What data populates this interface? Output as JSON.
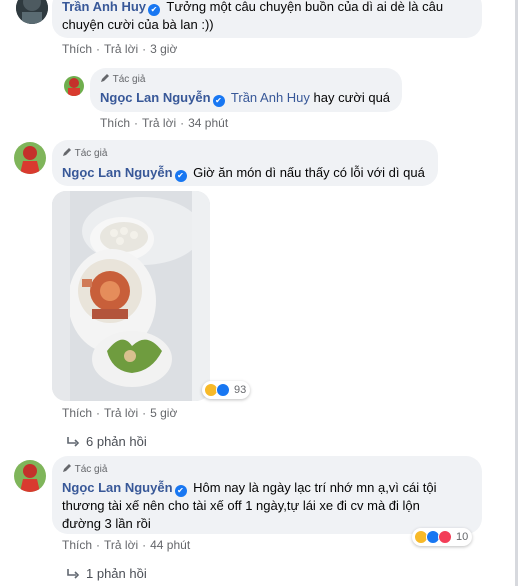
{
  "comments": [
    {
      "author": "Trần Anh Huy",
      "text_line1": "Tưởng một câu chuyện buồn của dì ai dè là câu",
      "text_line2": "chuyện cười của bà lan :))",
      "like": "Thích",
      "reply": "Trả lời",
      "time": "3 giờ"
    },
    {
      "tag": "Tác giả",
      "author": "Ngọc Lan Nguyễn",
      "mention": "Trần Anh Huy",
      "text": "hay cười quá",
      "like": "Thích",
      "reply": "Trả lời",
      "time": "34 phút"
    },
    {
      "tag": "Tác giả",
      "author": "Ngọc Lan Nguyễn",
      "text": "Giờ ăn món dì nấu thấy có lỗi với dì quá",
      "reaction_count": "93",
      "like": "Thích",
      "reply": "Trả lời",
      "time": "5 giờ",
      "replies": "6 phản hồi"
    },
    {
      "tag": "Tác giả",
      "author": "Ngọc Lan Nguyễn",
      "text_line1": "Hôm nay là ngày lạc trí nhớ mn ạ,vì cái tội",
      "text_line2": "thương tài xế nên cho tài xế off 1 ngày,tự lái xe đi cv mà đi lộn",
      "text_line3": "đường 3 lần rồi",
      "reaction_count": "10",
      "like": "Thích",
      "reply": "Trả lời",
      "time": "44 phút",
      "replies": "1 phản hồi"
    }
  ],
  "colors": {
    "name": "#385898",
    "bubble": "#f0f2f5",
    "meta": "#65676b",
    "verified": "#1877f2"
  }
}
